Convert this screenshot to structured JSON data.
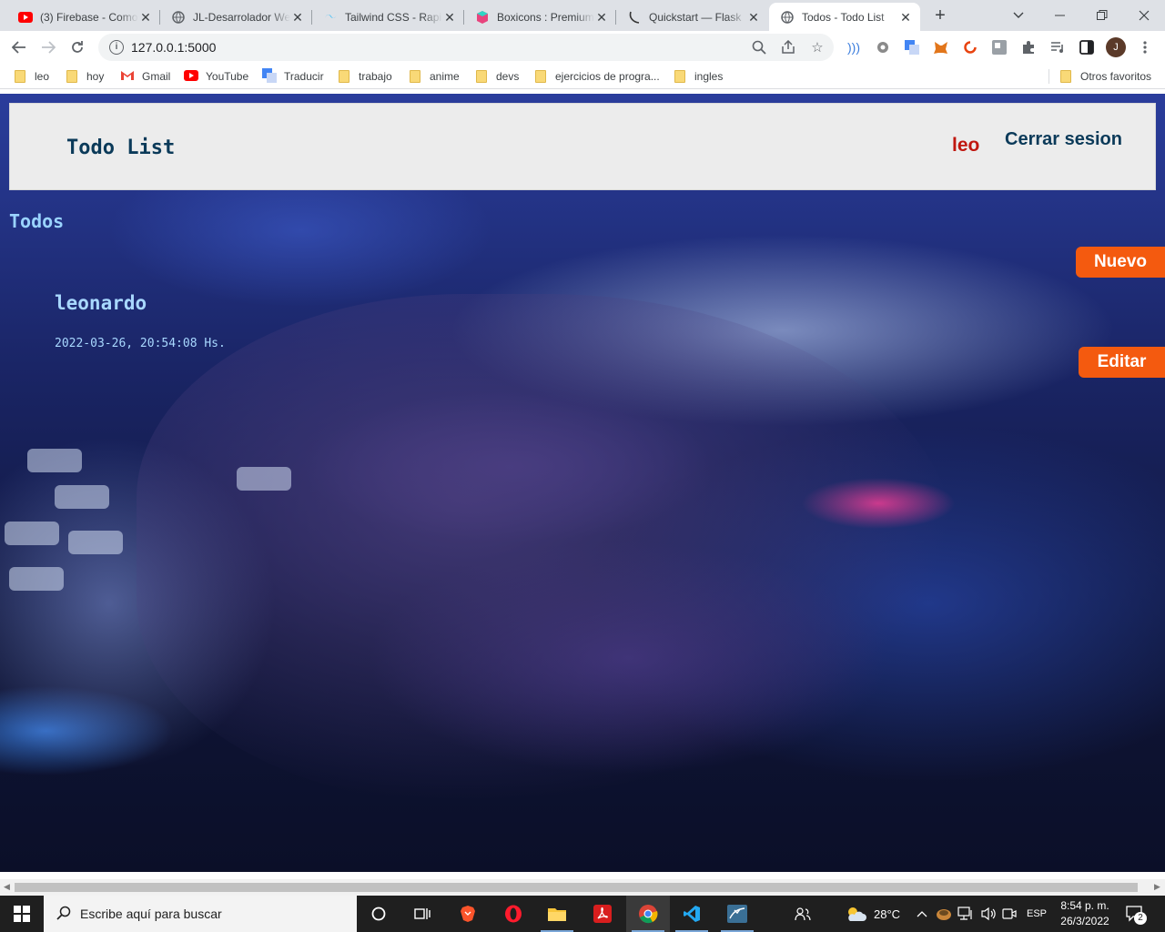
{
  "browser": {
    "tabs": [
      {
        "title": "(3) Firebase - Como",
        "icon": "youtube-icon"
      },
      {
        "title": "JL-Desarrolador Web",
        "icon": "globe-icon"
      },
      {
        "title": "Tailwind CSS - Rapid",
        "icon": "tailwind-icon"
      },
      {
        "title": "Boxicons : Premium",
        "icon": "boxicons-icon"
      },
      {
        "title": "Quickstart — Flask",
        "icon": "flask-icon"
      },
      {
        "title": "Todos - Todo List",
        "icon": "globe-icon",
        "active": true
      }
    ],
    "url": "127.0.0.1:5000",
    "profile_initial": "J",
    "bookmarks": [
      "leo",
      "hoy",
      "Gmail",
      "YouTube",
      "Traducir",
      "trabajo",
      "anime",
      "devs",
      "ejercicios de progra...",
      "ingles"
    ],
    "other_bookmarks": "Otros favoritos"
  },
  "page": {
    "brand": "Todo List",
    "username": "leo",
    "logout_label": "Cerrar sesion",
    "section_title": "Todos",
    "new_button": "Nuevo",
    "edit_button": "Editar",
    "todo": {
      "title": "leonardo",
      "date": "2022-03-26, 20:54:08 Hs."
    },
    "colors": {
      "accent": "#f45a0f",
      "brand": "#0b3a59",
      "username": "#c0170f",
      "header_bg": "#ececec"
    }
  },
  "taskbar": {
    "search_placeholder": "Escribe aquí para buscar",
    "temperature": "28°C",
    "language": "ESP",
    "time": "8:54 p. m.",
    "date": "26/3/2022",
    "notifications": "2"
  }
}
